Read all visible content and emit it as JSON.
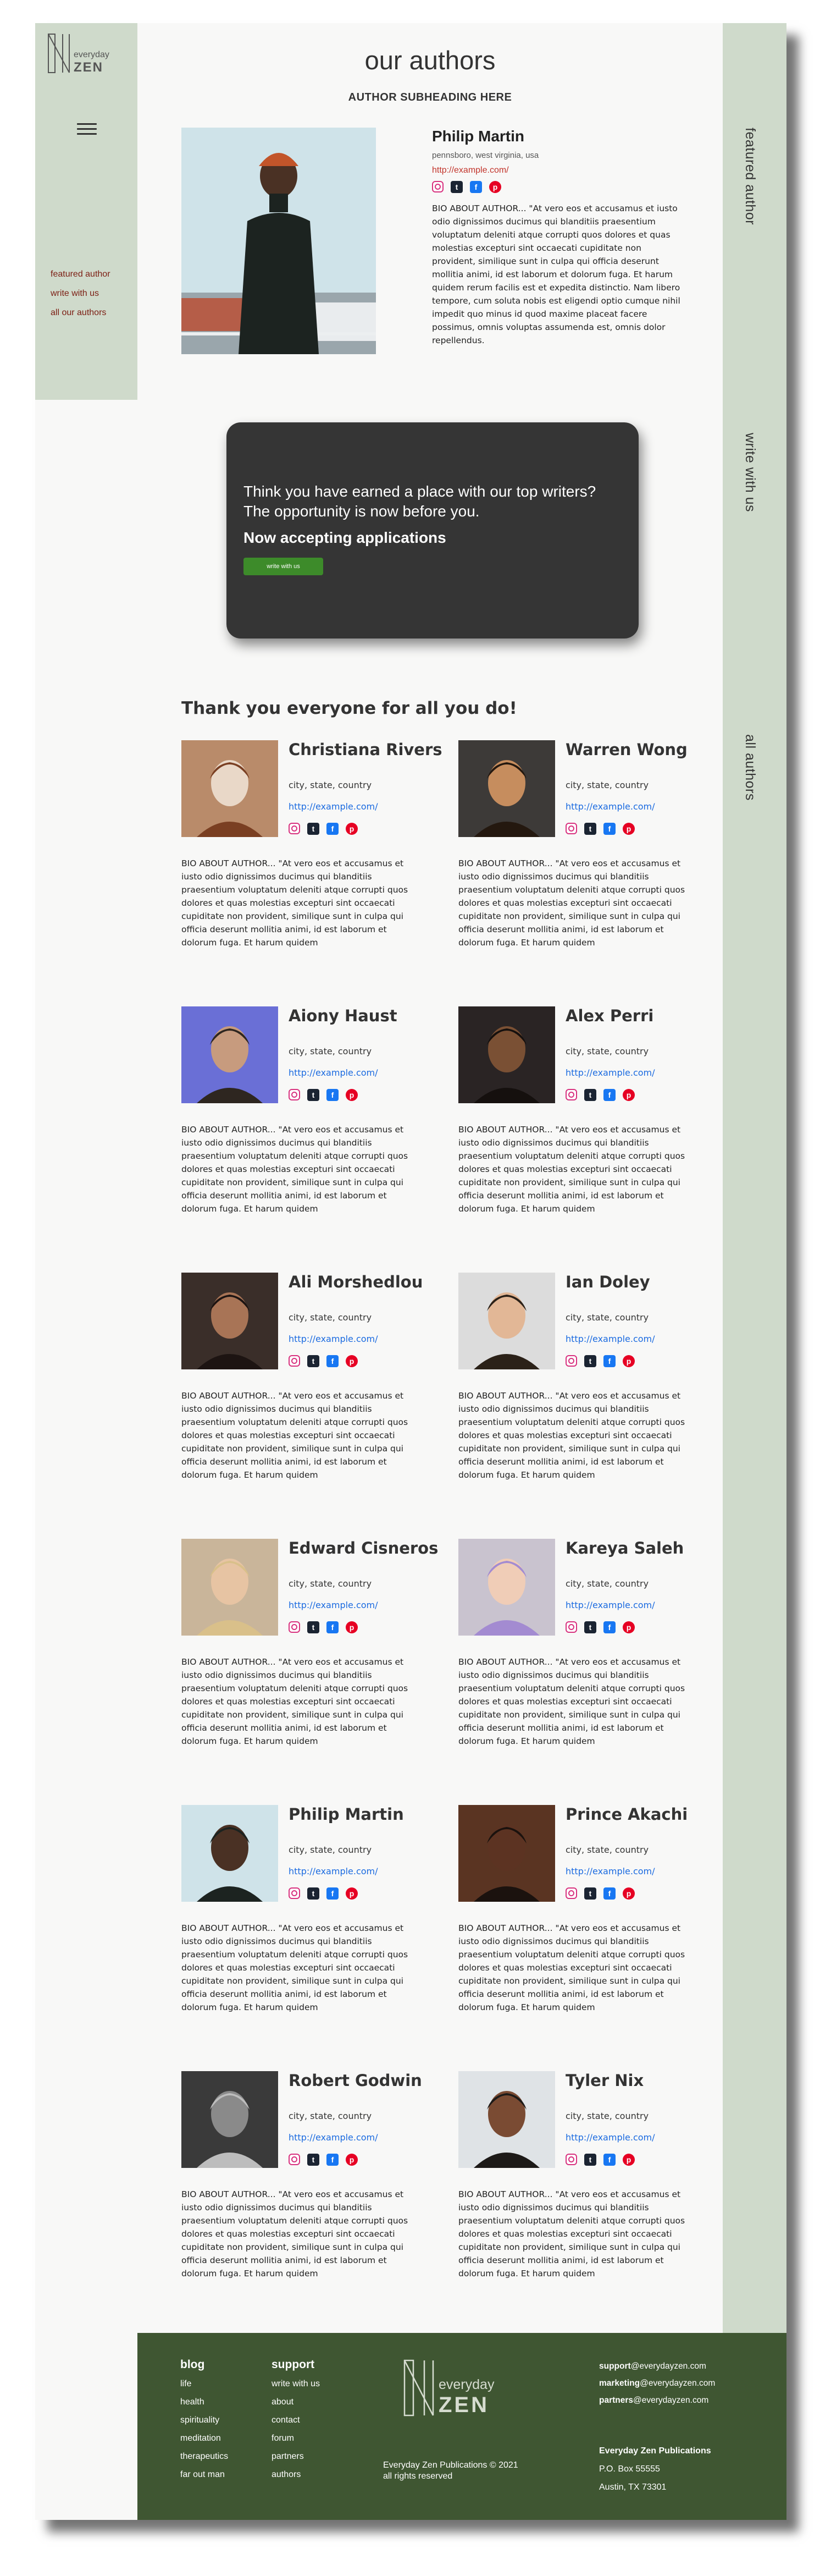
{
  "logo": {
    "line1": "everyday",
    "line2": "ZEN"
  },
  "sidebar": {
    "nav": [
      "featured author",
      "write with us",
      "all our authors"
    ]
  },
  "rail": [
    "featured author",
    "write with us",
    "all authors"
  ],
  "header": {
    "title": "our authors",
    "subheading": "AUTHOR SUBHEADING HERE"
  },
  "featured": {
    "name": "Philip Martin",
    "location": "pennsboro, west virginia, usa",
    "url": "http://example.com/",
    "bio": "BIO ABOUT AUTHOR... \"At vero eos et accusamus et iusto odio dignissimos ducimus qui blanditiis praesentium voluptatum deleniti atque corrupti quos dolores et quas molestias excepturi sint occaecati cupiditate non provident, similique sunt in culpa qui officia deserunt mollitia animi, id est laborum et dolorum fuga. Et harum quidem rerum facilis est et expedita distinctio. Nam libero tempore, cum soluta nobis est eligendi optio cumque nihil impedit quo minus id quod maxime placeat facere possimus, omnis voluptas assumenda est, omnis dolor repellendus."
  },
  "cta": {
    "text": "Think you have earned a place with our top writers? The opportunity is now before you.",
    "heading": "Now accepting applications",
    "button": "write with us"
  },
  "thanks": "Thank you everyone for all you do!",
  "social_icons": [
    "instagram-icon",
    "tumblr-icon",
    "facebook-icon",
    "pinterest-icon"
  ],
  "social_glyphs": {
    "tumblr": "t",
    "facebook": "f",
    "pinterest": "p"
  },
  "authors": [
    {
      "name": "Christiana Rivers",
      "location": "city, state, country",
      "url": "http://example.com/",
      "bio": "BIO ABOUT AUTHOR... \"At vero eos et accusamus et iusto odio dignissimos ducimus qui blanditiis praesentium voluptatum deleniti atque corrupti quos dolores et quas molestias excepturi sint occaecati cupiditate non provident, similique sunt in culpa qui officia deserunt mollitia animi, id est laborum et dolorum fuga. Et harum quidem"
    },
    {
      "name": "Warren Wong",
      "location": "city, state, country",
      "url": "http://example.com/",
      "bio": "BIO ABOUT AUTHOR... \"At vero eos et accusamus et iusto odio dignissimos ducimus qui blanditiis praesentium voluptatum deleniti atque corrupti quos dolores et quas molestias excepturi sint occaecati cupiditate non provident, similique sunt in culpa qui officia deserunt mollitia animi, id est laborum et dolorum fuga. Et harum quidem"
    },
    {
      "name": "Aiony Haust",
      "location": "city, state, country",
      "url": "http://example.com/",
      "bio": "BIO ABOUT AUTHOR... \"At vero eos et accusamus et iusto odio dignissimos ducimus qui blanditiis praesentium voluptatum deleniti atque corrupti quos dolores et quas molestias excepturi sint occaecati cupiditate non provident, similique sunt in culpa qui officia deserunt mollitia animi, id est laborum et dolorum fuga. Et harum quidem"
    },
    {
      "name": "Alex Perri",
      "location": "city, state, country",
      "url": "http://example.com/",
      "bio": "BIO ABOUT AUTHOR... \"At vero eos et accusamus et iusto odio dignissimos ducimus qui blanditiis praesentium voluptatum deleniti atque corrupti quos dolores et quas molestias excepturi sint occaecati cupiditate non provident, similique sunt in culpa qui officia deserunt mollitia animi, id est laborum et dolorum fuga. Et harum quidem"
    },
    {
      "name": "Ali Morshedlou",
      "location": "city, state, country",
      "url": "http://example.com/",
      "bio": "BIO ABOUT AUTHOR... \"At vero eos et accusamus et iusto odio dignissimos ducimus qui blanditiis praesentium voluptatum deleniti atque corrupti quos dolores et quas molestias excepturi sint occaecati cupiditate non provident, similique sunt in culpa qui officia deserunt mollitia animi, id est laborum et dolorum fuga. Et harum quidem"
    },
    {
      "name": "Ian Doley",
      "location": "city, state, country",
      "url": "http://example.com/",
      "bio": "BIO ABOUT AUTHOR... \"At vero eos et accusamus et iusto odio dignissimos ducimus qui blanditiis praesentium voluptatum deleniti atque corrupti quos dolores et quas molestias excepturi sint occaecati cupiditate non provident, similique sunt in culpa qui officia deserunt mollitia animi, id est laborum et dolorum fuga. Et harum quidem"
    },
    {
      "name": "Edward Cisneros",
      "location": "city, state, country",
      "url": "http://example.com/",
      "bio": "BIO ABOUT AUTHOR... \"At vero eos et accusamus et iusto odio dignissimos ducimus qui blanditiis praesentium voluptatum deleniti atque corrupti quos dolores et quas molestias excepturi sint occaecati cupiditate non provident, similique sunt in culpa qui officia deserunt mollitia animi, id est laborum et dolorum fuga. Et harum quidem"
    },
    {
      "name": "Kareya Saleh",
      "location": "city, state, country",
      "url": "http://example.com/",
      "bio": "BIO ABOUT AUTHOR... \"At vero eos et accusamus et iusto odio dignissimos ducimus qui blanditiis praesentium voluptatum deleniti atque corrupti quos dolores et quas molestias excepturi sint occaecati cupiditate non provident, similique sunt in culpa qui officia deserunt mollitia animi, id est laborum et dolorum fuga. Et harum quidem"
    },
    {
      "name": "Philip Martin",
      "location": "city, state, country",
      "url": "http://example.com/",
      "bio": "BIO ABOUT AUTHOR... \"At vero eos et accusamus et iusto odio dignissimos ducimus qui blanditiis praesentium voluptatum deleniti atque corrupti quos dolores et quas molestias excepturi sint occaecati cupiditate non provident, similique sunt in culpa qui officia deserunt mollitia animi, id est laborum et dolorum fuga. Et harum quidem"
    },
    {
      "name": "Prince Akachi",
      "location": "city, state, country",
      "url": "http://example.com/",
      "bio": "BIO ABOUT AUTHOR... \"At vero eos et accusamus et iusto odio dignissimos ducimus qui blanditiis praesentium voluptatum deleniti atque corrupti quos dolores et quas molestias excepturi sint occaecati cupiditate non provident, similique sunt in culpa qui officia deserunt mollitia animi, id est laborum et dolorum fuga. Et harum quidem"
    },
    {
      "name": "Robert Godwin",
      "location": "city, state, country",
      "url": "http://example.com/",
      "bio": "BIO ABOUT AUTHOR... \"At vero eos et accusamus et iusto odio dignissimos ducimus qui blanditiis praesentium voluptatum deleniti atque corrupti quos dolores et quas molestias excepturi sint occaecati cupiditate non provident, similique sunt in culpa qui officia deserunt mollitia animi, id est laborum et dolorum fuga. Et harum quidem"
    },
    {
      "name": "Tyler Nix",
      "location": "city, state, country",
      "url": "http://example.com/",
      "bio": "BIO ABOUT AUTHOR... \"At vero eos et accusamus et iusto odio dignissimos ducimus qui blanditiis praesentium voluptatum deleniti atque corrupti quos dolores et quas molestias excepturi sint occaecati cupiditate non provident, similique sunt in culpa qui officia deserunt mollitia animi, id est laborum et dolorum fuga. Et harum quidem"
    }
  ],
  "footer": {
    "blog": {
      "heading": "blog",
      "links": [
        "life",
        "health",
        "spirituality",
        "meditation",
        "therapeutics",
        "far out man"
      ]
    },
    "support": {
      "heading": "support",
      "links": [
        "write with us",
        "about",
        "contact",
        "forum",
        "partners",
        "authors"
      ]
    },
    "copyright": [
      "Everyday Zen Publications © 2021",
      "all rights reserved"
    ],
    "emails": [
      {
        "label": "support",
        "domain": "@everydayzen.com"
      },
      {
        "label": "marketing",
        "domain": "@everydayzen.com"
      },
      {
        "label": "partners",
        "domain": "@everydayzen.com"
      }
    ],
    "address": {
      "company": "Everyday Zen Publications",
      "line1": "P.O. Box 55555",
      "line2": "Austin, TX 73301"
    }
  },
  "colors": {
    "sidebar": "#cfdacb",
    "footer": "#3f5632",
    "nav_link": "#7b1d12",
    "link_blue": "#1a6ae0",
    "cta_bg": "#353535",
    "cta_button": "#3d8b2a"
  }
}
